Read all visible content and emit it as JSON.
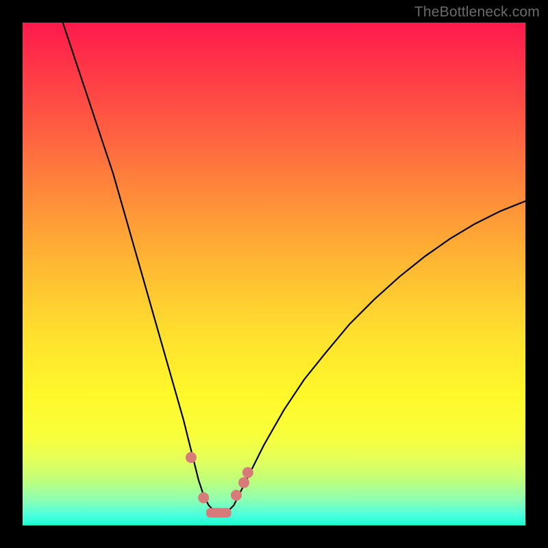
{
  "watermark": "TheBottleneck.com",
  "colors": {
    "frame": "#000000",
    "curve": "#000000",
    "marker": "#d97a7a",
    "gradient_top": "#ff1a4d",
    "gradient_bottom": "#18ffce"
  },
  "chart_data": {
    "type": "line",
    "title": "",
    "xlabel": "",
    "ylabel": "",
    "xlim": [
      0,
      100
    ],
    "ylim": [
      0,
      100
    ],
    "series": [
      {
        "name": "bottleneck-curve",
        "x": [
          8,
          10,
          12,
          14,
          16,
          18,
          20,
          22,
          24,
          26,
          28,
          30,
          32,
          33,
          34,
          35,
          36,
          37,
          38,
          39,
          40,
          41,
          42,
          43,
          45,
          48,
          52,
          56,
          60,
          65,
          70,
          75,
          80,
          85,
          90,
          95,
          100
        ],
        "values": [
          100,
          94,
          88,
          82,
          76,
          70,
          63,
          56,
          49,
          42,
          35,
          28,
          21,
          17,
          13,
          9,
          6,
          4,
          3,
          2.5,
          2.5,
          3,
          4,
          6,
          10,
          16,
          23,
          29,
          34,
          40,
          45,
          49.5,
          53.5,
          57,
          60,
          62.5,
          64.5
        ]
      }
    ],
    "markers": {
      "name": "highlight-dots",
      "x": [
        33.5,
        36.0,
        42.5,
        44.0,
        44.8
      ],
      "values": [
        13.5,
        5.5,
        6.0,
        8.5,
        10.5
      ]
    },
    "flat_segment": {
      "name": "valley-bar",
      "x_start": 36.5,
      "x_end": 41.5,
      "y": 2.5
    }
  }
}
